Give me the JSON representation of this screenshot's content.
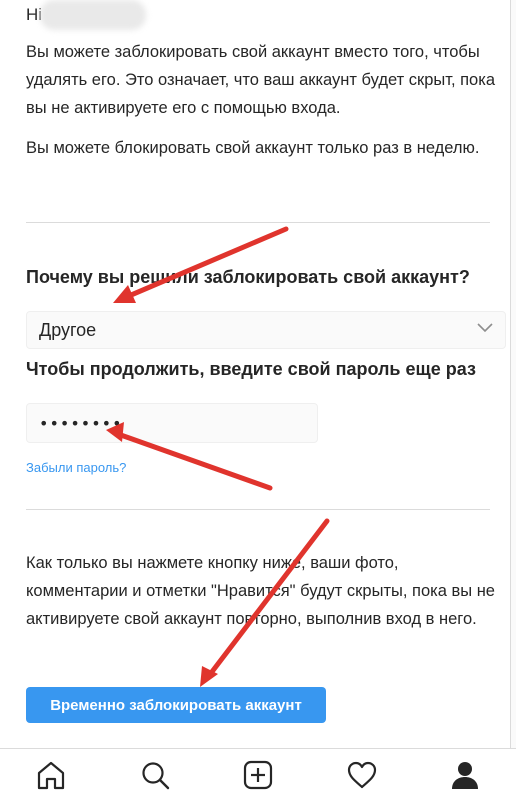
{
  "greeting": "Hi",
  "intro": "Вы можете заблокировать свой аккаунт вместо того, чтобы удалять его. Это означает, что ваш аккаунт будет скрыт, пока вы не активируете его с помощью входа.",
  "once_per_week": "Вы можете блокировать свой аккаунт только раз в неделю.",
  "reason": {
    "label": "Почему вы решили заблокировать свой аккаунт?",
    "selected": "Другое"
  },
  "password": {
    "label": "Чтобы продолжить, введите свой пароль еще раз",
    "value": "••••••••"
  },
  "forgot_link": "Забыли пароль?",
  "notice": "Как только вы нажмете кнопку ниже, ваши фото, комментарии и отметки \"Нравится\" будут скрыты, пока вы не активируете свой аккаунт повторно, выполнив вход в него.",
  "submit_label": "Временно заблокировать аккаунт",
  "colors": {
    "accent": "#3897f0",
    "annotation_arrow": "#e0342d"
  },
  "nav_icons": [
    "home-icon",
    "search-icon",
    "new-post-icon",
    "heart-icon",
    "profile-icon"
  ]
}
